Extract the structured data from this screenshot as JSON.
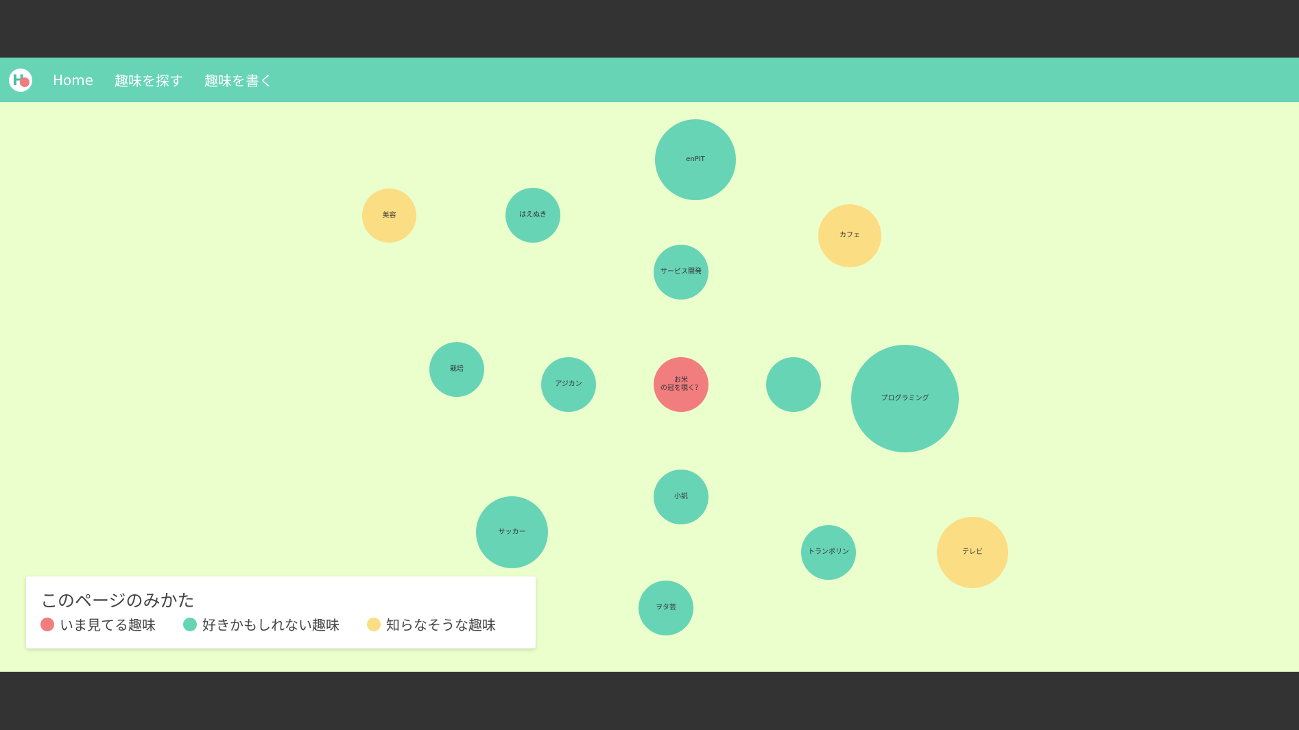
{
  "nav": {
    "logo_icon": "hobby-logo-icon",
    "links": [
      "Home",
      "趣味を探す",
      "趣味を書く"
    ]
  },
  "colors": {
    "nav_background": "#67d4b5",
    "canvas_background": "#eaffcc",
    "current_hobby": "#f27d7f",
    "maybe_like_hobby": "#67d4b5",
    "unknown_hobby": "#fbdd84",
    "frame": "#333333"
  },
  "hobbies": {
    "center": "お米\nの冠を覗く？",
    "enpit": "enPIT",
    "biyou": "美容",
    "haenuki": "はえぬき",
    "cafe": "カフェ",
    "service": "サービス開発",
    "saibai": "栽培",
    "ajikan": "アジカン",
    "programming": "プログラミング",
    "shousetsu": "小説",
    "soccer": "サッカー",
    "trampoline": "トランポリン",
    "tv": "テレビ",
    "wotagei": "ヲタ芸"
  },
  "legend": {
    "title": "このページのみかた",
    "items": [
      "いま見てる趣味",
      "好きかもしれない趣味",
      "知らなそうな趣味"
    ]
  }
}
